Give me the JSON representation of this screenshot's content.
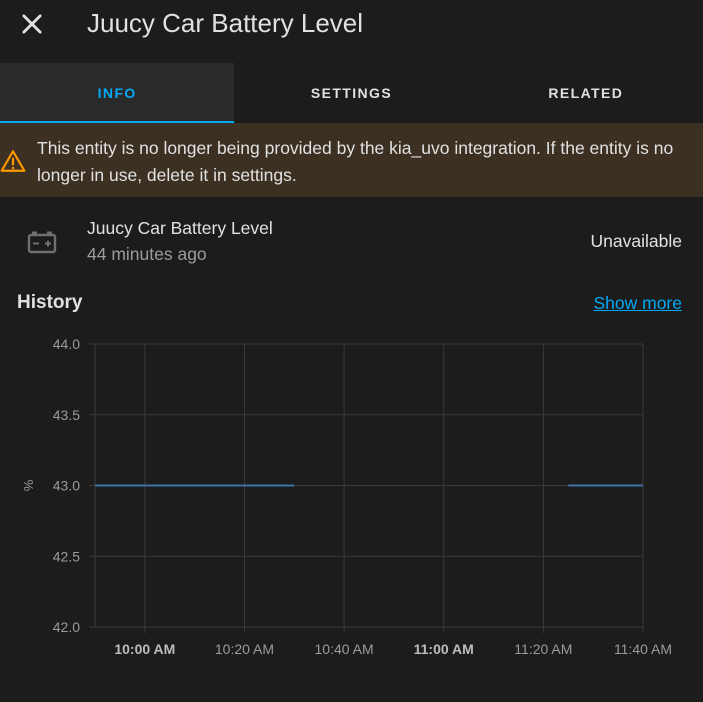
{
  "header": {
    "title": "Juucy Car Battery Level",
    "close_icon": "close-icon"
  },
  "tabs": [
    {
      "label": "INFO",
      "active": true
    },
    {
      "label": "SETTINGS",
      "active": false
    },
    {
      "label": "RELATED",
      "active": false
    }
  ],
  "warning": {
    "icon": "warning-icon",
    "text": "This entity is no longer being provided by the kia_uvo integration. If the entity is no longer in use, delete it in settings."
  },
  "entity": {
    "icon": "battery-icon",
    "name": "Juucy Car Battery Level",
    "last_changed": "44 minutes ago",
    "state": "Unavailable"
  },
  "history": {
    "title": "History",
    "show_more": "Show more"
  },
  "colors": {
    "accent": "#03a9f4",
    "warning": "#ff9800",
    "background": "#1c1c1c",
    "warning_bg": "#3b3022",
    "series": "#3e73a8"
  },
  "chart_data": {
    "type": "line",
    "ylabel": "%",
    "ylim": [
      42.0,
      44.0
    ],
    "y_ticks": [
      "44.0",
      "43.5",
      "43.0",
      "42.5",
      "42.0"
    ],
    "x_ticks": [
      {
        "label": "10:00 AM",
        "bold": true
      },
      {
        "label": "10:20 AM",
        "bold": false
      },
      {
        "label": "10:40 AM",
        "bold": false
      },
      {
        "label": "11:00 AM",
        "bold": true
      },
      {
        "label": "11:20 AM",
        "bold": false
      },
      {
        "label": "11:40 AM",
        "bold": false
      }
    ],
    "xlim": [
      "09:50",
      "11:40"
    ],
    "grid": true,
    "series": [
      {
        "segments": [
          [
            {
              "x": "09:50",
              "y": 43.0
            },
            {
              "x": "10:30",
              "y": 43.0
            }
          ],
          [
            {
              "x": "11:25",
              "y": 43.0
            },
            {
              "x": "11:40",
              "y": 43.0
            }
          ]
        ]
      }
    ]
  }
}
